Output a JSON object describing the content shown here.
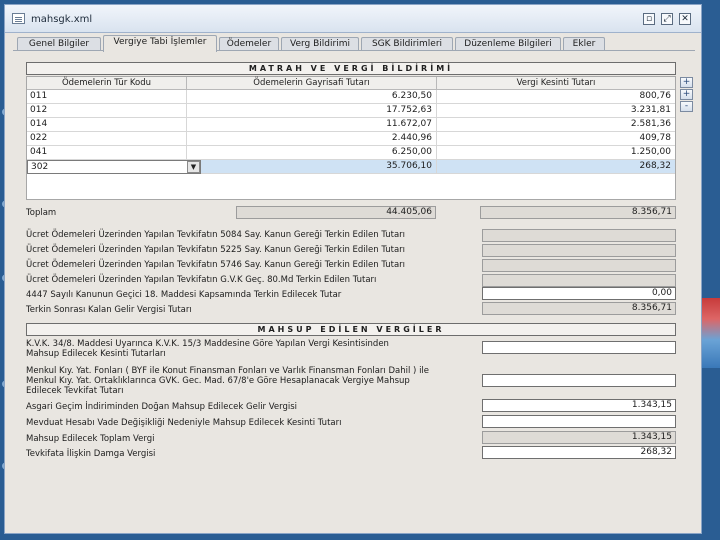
{
  "window": {
    "title": "mahsgk.xml",
    "controls": {
      "minimize": "▫",
      "restore": "⤢",
      "close": "✕"
    }
  },
  "tabs": [
    {
      "label": "Genel Bilgiler"
    },
    {
      "label": "Vergiye Tabi İşlemler",
      "active": true
    },
    {
      "label": "Ödemeler"
    },
    {
      "label": "Verg Bildirimi"
    },
    {
      "label": "SGK Bildirimleri"
    },
    {
      "label": "Düzenleme Bilgileri"
    },
    {
      "label": "Ekler"
    }
  ],
  "matrah": {
    "title": "MATRAH VE VERGİ BİLDİRİMİ",
    "columns": [
      "Ödemelerin Tür Kodu",
      "Ödemelerin Gayrisafi Tutarı",
      "Vergi Kesinti Tutarı"
    ],
    "rows": [
      {
        "code": "011",
        "gross": "6.230,50",
        "tax": "800,76"
      },
      {
        "code": "012",
        "gross": "17.752,63",
        "tax": "3.231,81"
      },
      {
        "code": "014",
        "gross": "11.672,07",
        "tax": "2.581,36"
      },
      {
        "code": "022",
        "gross": "2.440,96",
        "tax": "409,78"
      },
      {
        "code": "041",
        "gross": "6.250,00",
        "tax": "1.250,00"
      },
      {
        "code": "302",
        "gross": "35.706,10",
        "tax": "268,32",
        "selected": true
      }
    ],
    "side_buttons": [
      "+",
      "+",
      "-"
    ],
    "total_label": "Toplam",
    "total_gross": "44.405,06",
    "total_tax": "8.356,71"
  },
  "deductions": [
    {
      "label": "Ücret Ödemeleri Üzerinden Yapılan Tevkifatın 5084 Say. Kanun Gereği Terkin Edilen Tutarı",
      "value": ""
    },
    {
      "label": "Ücret Ödemeleri Üzerinden Yapılan Tevkifatın 5225 Say. Kanun Gereği Terkin Edilen Tutarı",
      "value": ""
    },
    {
      "label": "Ücret Ödemeleri Üzerinden Yapılan Tevkifatın 5746 Say. Kanun Gereği Terkin Edilen Tutarı",
      "value": ""
    },
    {
      "label": "Ücret Ödemeleri Üzerinden Yapılan Tevkifatın G.V.K Geç. 80.Md Terkin Edilen Tutarı",
      "value": ""
    },
    {
      "label": "4447 Sayılı Kanunun Geçici 18. Maddesi Kapsamında Terkin Edilecek Tutar",
      "value": "0,00"
    },
    {
      "label": "Terkin Sonrası Kalan Gelir Vergisi Tutarı",
      "value": "8.356,71"
    }
  ],
  "mahsup": {
    "title": "MAHSUP EDİLEN VERGİLER",
    "items": [
      {
        "label1": "K.V.K. 34/8. Maddesi Uyarınca K.V.K. 15/3 Maddesine Göre Yapılan Vergi Kesintisinden",
        "label2": "Mahsup Edilecek Kesinti Tutarları",
        "value": ""
      },
      {
        "label1": "Menkul Kıy. Yat. Fonları ( BYF ile Konut Finansman Fonları ve Varlık Finansman Fonları Dahil ) ile",
        "label2": "Menkul Kıy. Yat. Ortaklıklarınca GVK. Gec. Mad. 67/8'e Göre Hesaplanacak Vergiye Mahsup",
        "label3": "Edilecek Tevkifat Tutarı",
        "value": ""
      },
      {
        "label1": "Asgari Geçim İndiriminden Doğan Mahsup Edilecek Gelir Vergisi",
        "value": "1.343,15"
      },
      {
        "label1": "Mevduat Hesabı Vade Değişikliği Nedeniyle Mahsup Edilecek Kesinti Tutarı",
        "value": ""
      },
      {
        "label1": "Mahsup Edilecek Toplam Vergi",
        "value": "1.343,15"
      },
      {
        "label1": "Tevkifata İlişkin Damga Vergisi",
        "value": "268,32"
      }
    ]
  },
  "colors": {
    "window_bg": "#e9e6e1",
    "desktop": "#2a5d93",
    "selected_row": "#cfe2f4"
  }
}
